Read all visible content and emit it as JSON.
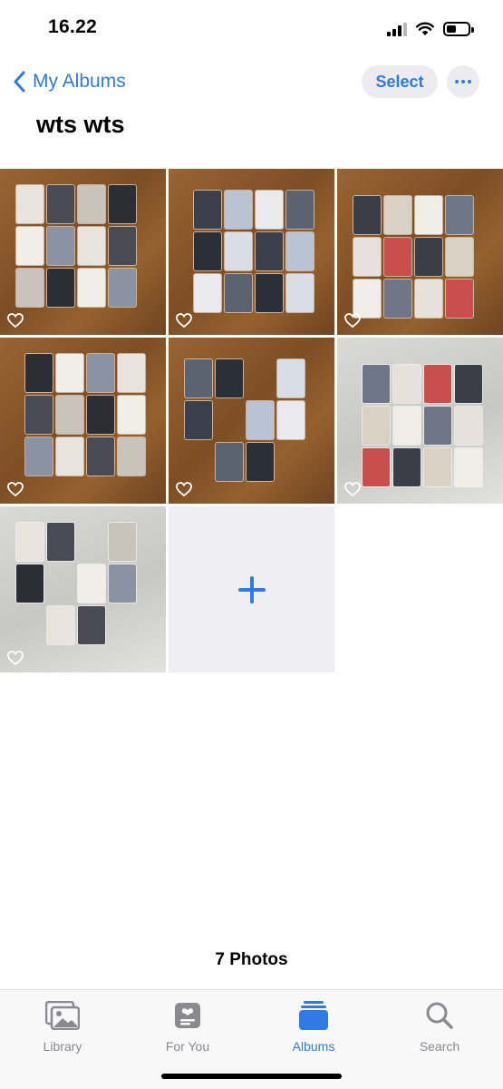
{
  "status_bar": {
    "time": "16.22",
    "battery_level": 0.45
  },
  "nav": {
    "back_label": "My Albums",
    "select_label": "Select"
  },
  "album": {
    "title": "wts wts",
    "photo_count": "7 Photos"
  },
  "photos": [
    {
      "favorited": false
    },
    {
      "favorited": false
    },
    {
      "favorited": false
    },
    {
      "favorited": false
    },
    {
      "favorited": false
    },
    {
      "favorited": false
    },
    {
      "favorited": false
    }
  ],
  "tabs": [
    {
      "label": "Library",
      "icon": "photo-library-icon",
      "active": false
    },
    {
      "label": "For You",
      "icon": "for-you-icon",
      "active": false
    },
    {
      "label": "Albums",
      "icon": "albums-icon",
      "active": true
    },
    {
      "label": "Search",
      "icon": "search-icon",
      "active": false
    }
  ],
  "colors": {
    "accent": "#2f7ae5",
    "inactive": "#8a8a8e",
    "add_tile": "#efeff3"
  }
}
